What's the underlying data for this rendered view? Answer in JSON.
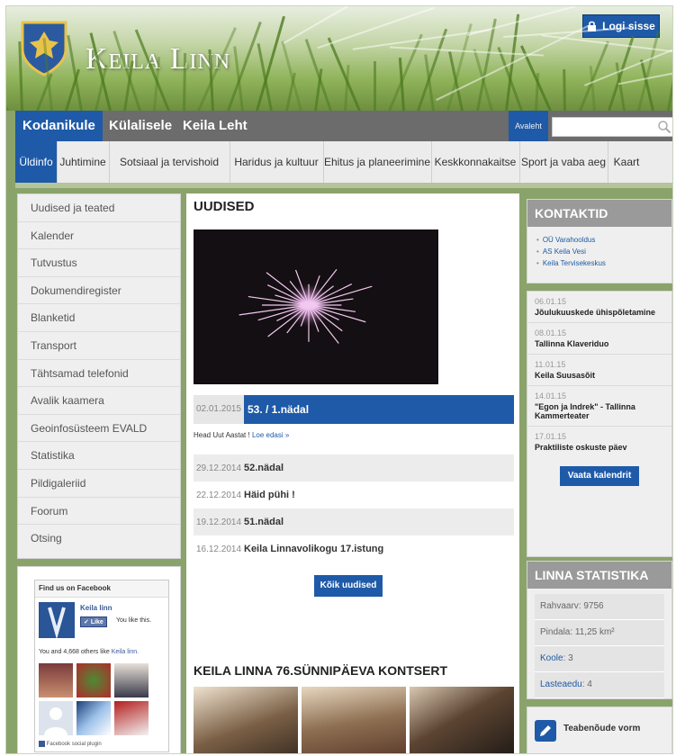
{
  "header": {
    "site_title": "Keila Linn",
    "login_label": "Logi sisse"
  },
  "topnav": {
    "tabs": [
      {
        "label": "Kodanikule",
        "active": true
      },
      {
        "label": "Külalisele",
        "active": false
      },
      {
        "label": "Keila Leht",
        "active": false
      }
    ],
    "home_label": "Avaleht",
    "search_placeholder": ""
  },
  "subnav": {
    "items": [
      {
        "label": "Üldinfo",
        "active": true
      },
      {
        "label": "Juhtimine"
      },
      {
        "label": "Sotsiaal ja tervishoid"
      },
      {
        "label": "Haridus ja kultuur"
      },
      {
        "label": "Ehitus ja planeerimine"
      },
      {
        "label": "Keskkonnakaitse"
      },
      {
        "label": "Sport ja vaba aeg"
      },
      {
        "label": "Kaart"
      }
    ]
  },
  "sidebar": {
    "items": [
      "Uudised ja teated",
      "Kalender",
      "Tutvustus",
      "Dokumendiregister",
      "Blanketid",
      "Transport",
      "Tähtsamad telefonid",
      "Avalik kaamera",
      "Geoinfosüsteem EVALD",
      "Statistika",
      "Pildigaleriid",
      "Foorum",
      "Otsing"
    ]
  },
  "facebook": {
    "title": "Find us on Facebook",
    "page_name": "Keila linn",
    "like_label": "Like",
    "likes_you": "You like this.",
    "others_prefix": "You and 4,668 others like",
    "others_link": "Keila linn.",
    "plugin_label": "Facebook social plugin"
  },
  "news": {
    "heading": "UUDISED",
    "featured": {
      "date": "02.01.2015",
      "title": "53. / 1.nädal"
    },
    "teaser": "Head Uut Aastat !",
    "read_more": "Loe edasi »",
    "items": [
      {
        "date": "29.12.2014",
        "title": "52.nädal"
      },
      {
        "date": "22.12.2014",
        "title": "Häid pühi !"
      },
      {
        "date": "19.12.2014",
        "title": "51.nädal"
      },
      {
        "date": "16.12.2014",
        "title": "Keila Linnavolikogu 17.istung"
      }
    ],
    "all_news_label": "Kõik uudised"
  },
  "concert": {
    "heading": "KEILA LINNA 76.SÜNNIPÄEVA KONTSERT"
  },
  "contacts": {
    "heading": "KONTAKTID",
    "links": [
      "OÜ Varahooldus",
      "AS Keila Vesi",
      "Keila Tervisekeskus"
    ]
  },
  "events": {
    "items": [
      {
        "date": "06.01.15",
        "title": "Jõulukuuskede ühispõletamine"
      },
      {
        "date": "08.01.15",
        "title": "Tallinna Klaveriduo"
      },
      {
        "date": "11.01.15",
        "title": "Keila Suusasõit"
      },
      {
        "date": "14.01.15",
        "title": "\"Egon ja Indrek\" - Tallinna Kammerteater"
      },
      {
        "date": "17.01.15",
        "title": "Praktiliste oskuste päev"
      }
    ],
    "calendar_label": "Vaata kalendrit"
  },
  "stats": {
    "heading": "LINNA STATISTIKA",
    "rows": [
      {
        "label": "Rahvaarv: 9756"
      },
      {
        "label": "Pindala: 11,25 km²"
      },
      {
        "link": "Koole",
        "value": ": 3"
      },
      {
        "link": "Lasteaedu",
        "value": ": 4"
      }
    ]
  },
  "form": {
    "label": "Teabenõude vorm"
  }
}
